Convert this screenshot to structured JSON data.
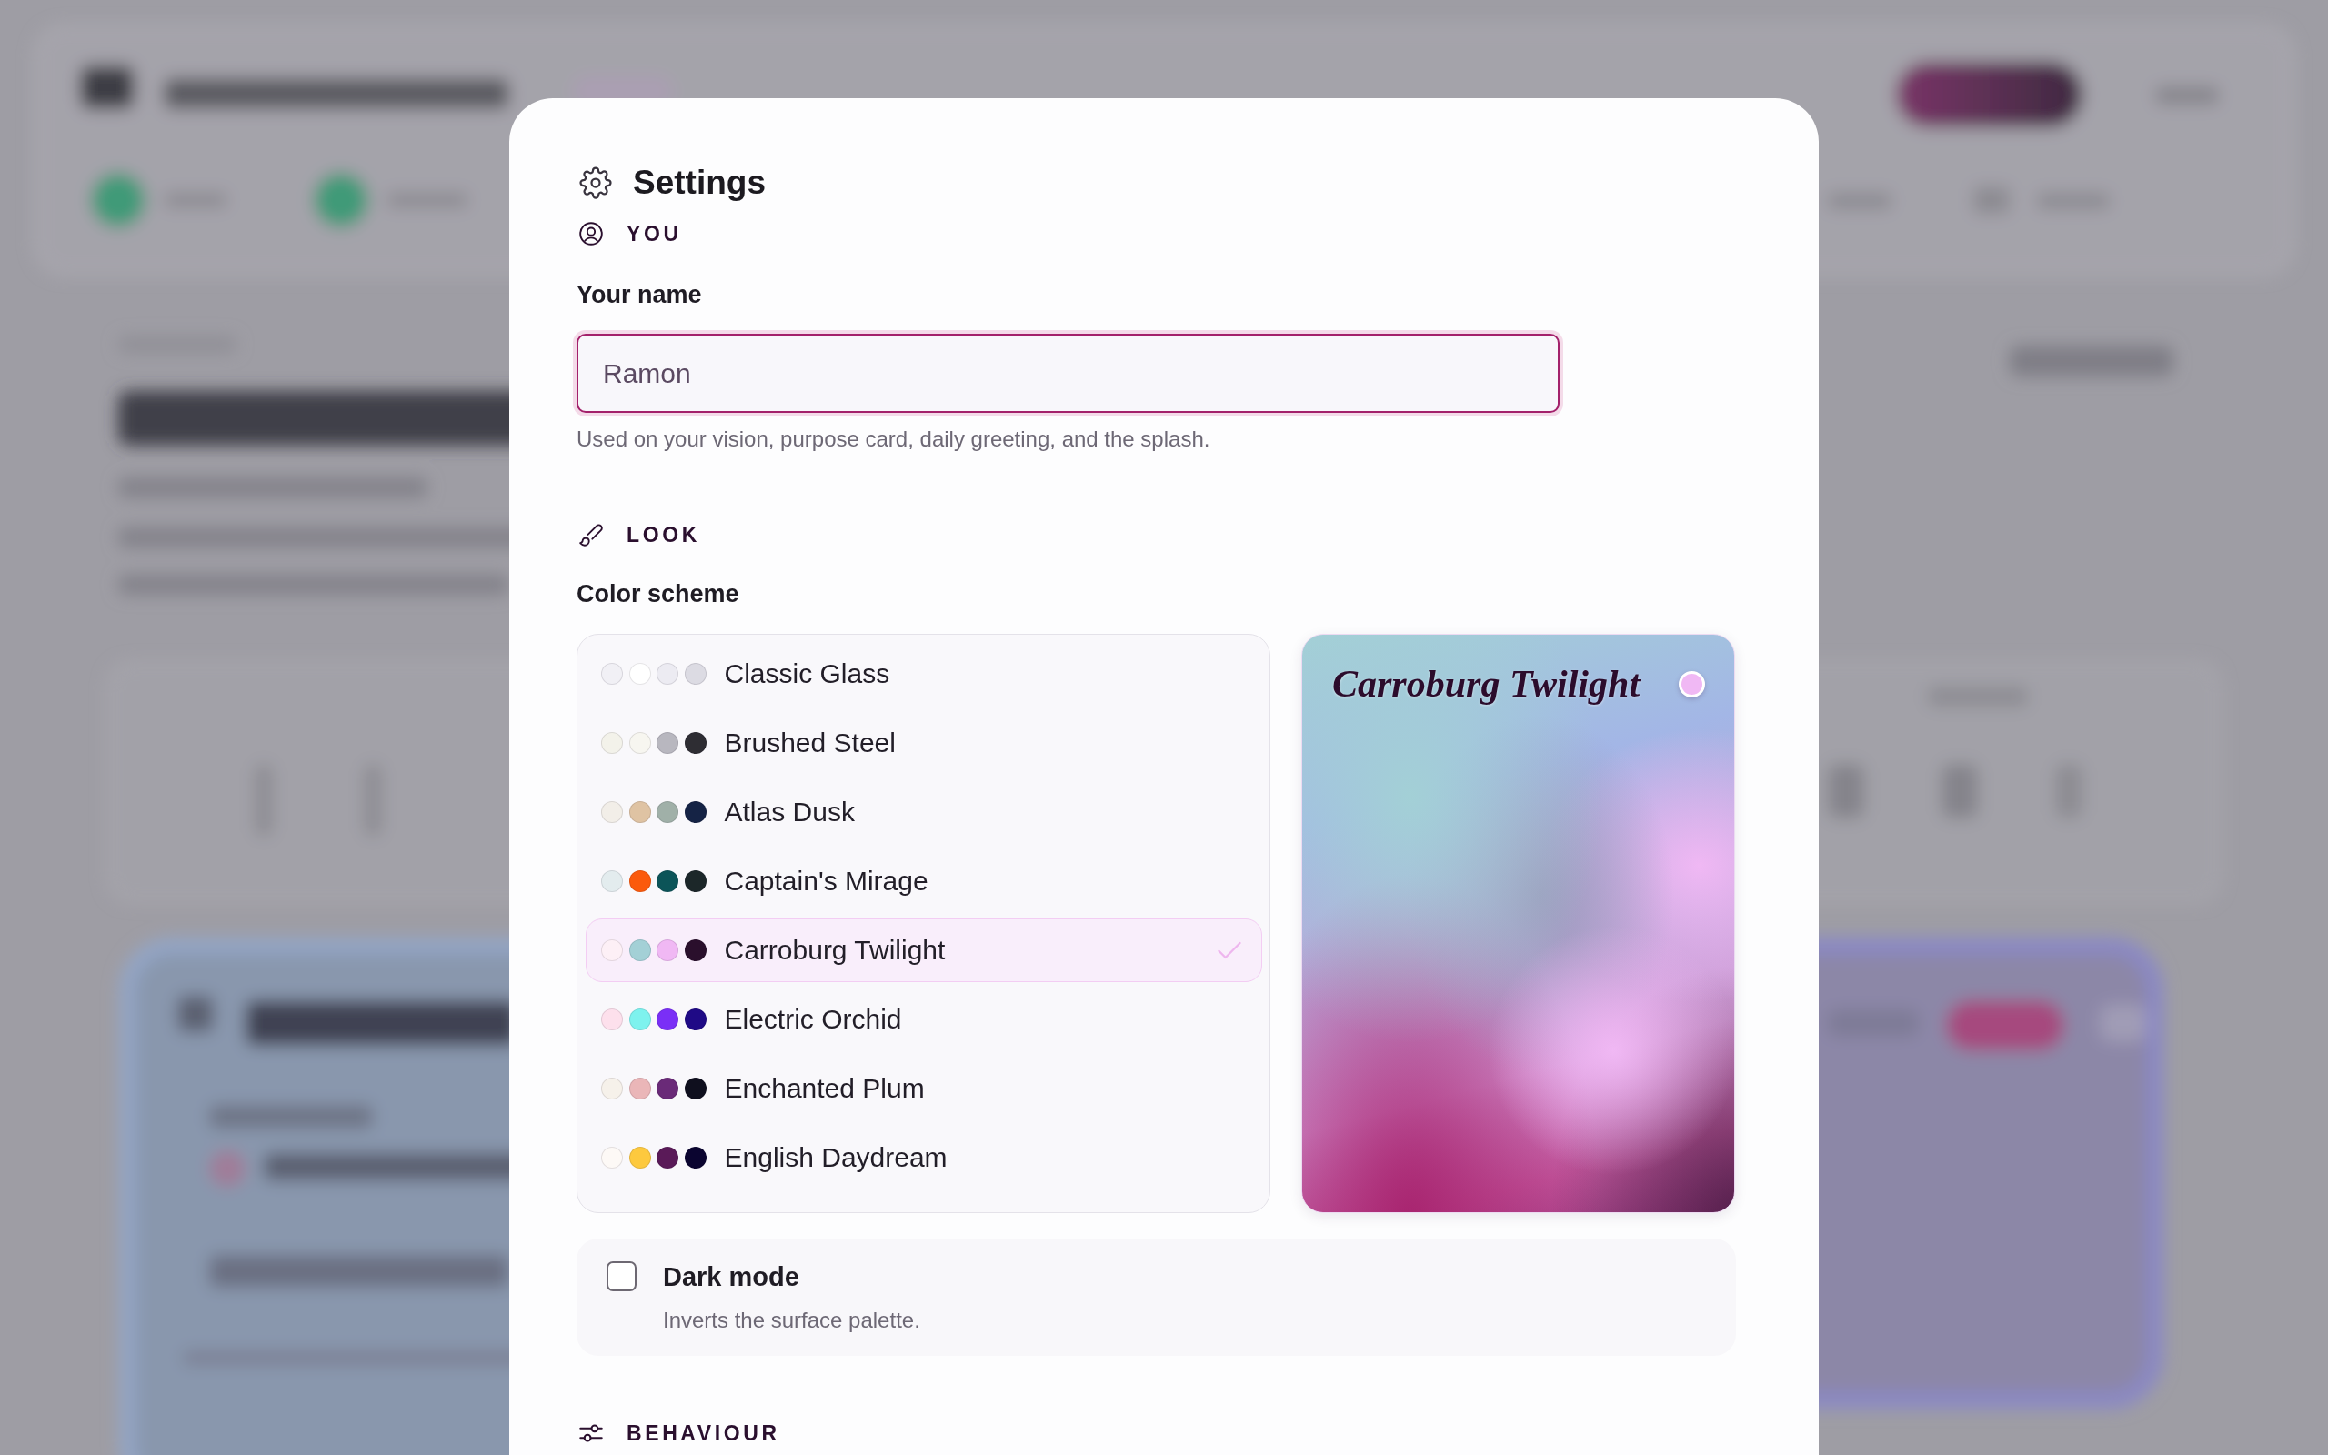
{
  "dialog": {
    "title": "Settings"
  },
  "you": {
    "heading": "YOU",
    "name_field": {
      "label": "Your name",
      "value": "Ramon",
      "focused": true,
      "hint": "Used on your vision, purpose card, daily greeting, and the splash."
    }
  },
  "look": {
    "heading": "LOOK",
    "color_scheme": {
      "label": "Color scheme",
      "schemes": [
        {
          "name": "Classic Glass",
          "selected": false,
          "swatches": [
            {
              "color": "#f1f0f5"
            },
            {
              "color": "#ffffff"
            },
            {
              "color": "#ecebf2"
            },
            {
              "color": "#dcdbe3"
            }
          ]
        },
        {
          "name": "Brushed Steel",
          "selected": false,
          "swatches": [
            {
              "color": "#f3f2ea"
            },
            {
              "color": "#f7f6f0"
            },
            {
              "color": "#b8b7bf"
            },
            {
              "color": "#2e2d33"
            }
          ]
        },
        {
          "name": "Atlas Dusk",
          "selected": false,
          "swatches": [
            {
              "color": "#f2eee8"
            },
            {
              "color": "#dfc3a3"
            },
            {
              "color": "#a0b0a8"
            },
            {
              "color": "#152345"
            }
          ]
        },
        {
          "name": "Captain's Mirage",
          "selected": false,
          "swatches": [
            {
              "color": "#e3ecee"
            },
            {
              "color": "#fb5a0c"
            },
            {
              "color": "#0c5458"
            },
            {
              "color": "#1c2729"
            }
          ]
        },
        {
          "name": "Carroburg Twilight",
          "selected": true,
          "swatches": [
            {
              "color": "#fdf0f6"
            },
            {
              "color": "#a3d0d6"
            },
            {
              "color": "#f0b8f4"
            },
            {
              "color": "#2a0f2c"
            }
          ]
        },
        {
          "name": "Electric Orchid",
          "selected": false,
          "swatches": [
            {
              "color": "#fde0ec"
            },
            {
              "color": "#7ef2ee"
            },
            {
              "color": "#7a2ff6"
            },
            {
              "color": "#1f0a86"
            }
          ]
        },
        {
          "name": "Enchanted Plum",
          "selected": false,
          "swatches": [
            {
              "color": "#f6f1ea"
            },
            {
              "color": "#eab6b8"
            },
            {
              "color": "#6a2a78"
            },
            {
              "color": "#0f0f1e"
            }
          ]
        },
        {
          "name": "English Daydream",
          "selected": false,
          "swatches": [
            {
              "color": "#fdf9f6"
            },
            {
              "color": "#fdc93e"
            },
            {
              "color": "#5a1a58"
            },
            {
              "color": "#0b0530"
            }
          ]
        }
      ],
      "preview": {
        "title": "Carroburg Twilight"
      }
    },
    "dark_mode": {
      "label": "Dark mode",
      "description": "Inverts the surface palette.",
      "checked": false
    }
  },
  "behaviour": {
    "heading": "BEHAVIOUR"
  }
}
